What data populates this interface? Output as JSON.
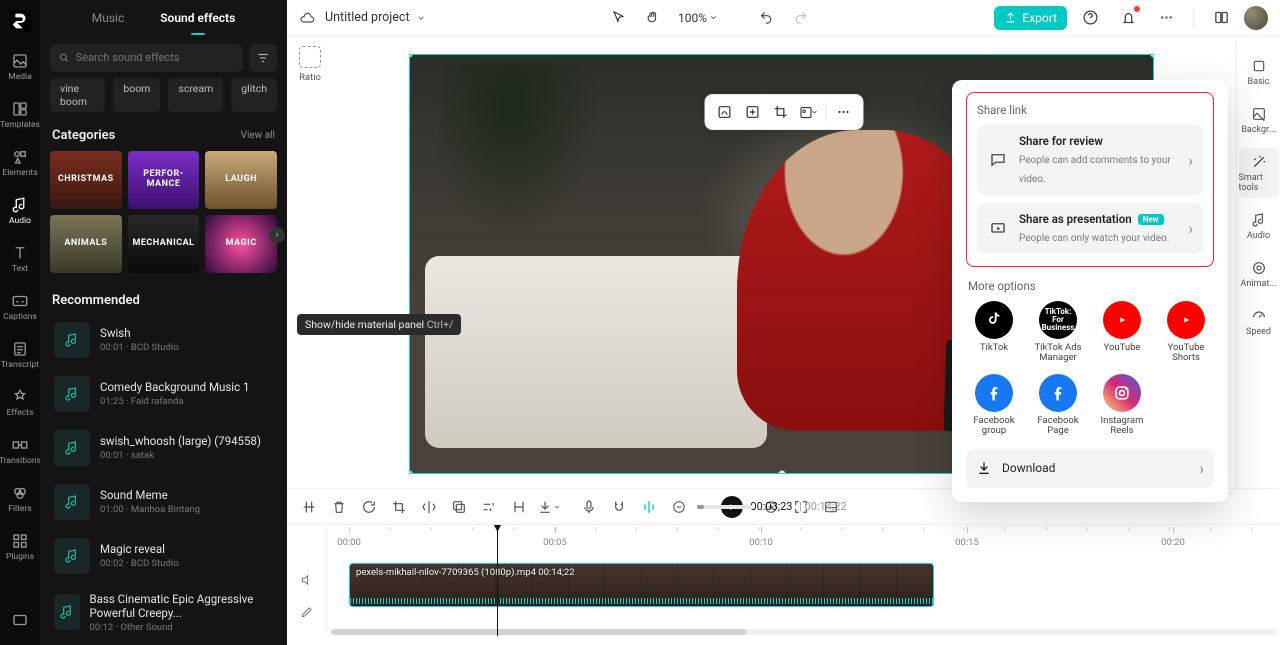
{
  "app": {
    "title": "Untitled project"
  },
  "leftSidebar": {
    "items": [
      {
        "key": "media",
        "label": "Media"
      },
      {
        "key": "templates",
        "label": "Templates"
      },
      {
        "key": "elements",
        "label": "Elements"
      },
      {
        "key": "audio",
        "label": "Audio"
      },
      {
        "key": "text",
        "label": "Text"
      },
      {
        "key": "captions",
        "label": "Captions"
      },
      {
        "key": "transcript",
        "label": "Transcript"
      },
      {
        "key": "effects",
        "label": "Effects"
      },
      {
        "key": "transitions",
        "label": "Transitions"
      },
      {
        "key": "filters",
        "label": "Filters"
      },
      {
        "key": "plugins",
        "label": "Plugins"
      }
    ]
  },
  "mediaPanel": {
    "tabs": {
      "music": "Music",
      "sfx": "Sound effects",
      "active": "sfx"
    },
    "search": {
      "placeholder": "Search sound effects"
    },
    "chips": [
      "vine boom",
      "boom",
      "scream",
      "glitch"
    ],
    "catHeader": "Categories",
    "viewAll": "View all",
    "categories": [
      [
        "CHRISTMAS",
        "PERFOR-\nMANCE",
        "LAUGH"
      ],
      [
        "ANIMALS",
        "MECHANICAL",
        "MAGIC"
      ]
    ],
    "catColors": [
      [
        "#7a2f20",
        "#7a2ec7",
        "#b38d5a"
      ],
      [
        "#6b6a55",
        "#141414",
        "#0e0e0e"
      ]
    ],
    "recHeader": "Recommended",
    "tracks": [
      {
        "title": "Swish",
        "meta": "00:01 · BCD Studio"
      },
      {
        "title": "Comedy Background Music 1",
        "meta": "01:25 · Faid rafanda"
      },
      {
        "title": "swish_whoosh (large) (794558)",
        "meta": "00:01 · satak"
      },
      {
        "title": "Sound Meme",
        "meta": "01:00 · Manhoa Bintang"
      },
      {
        "title": "Magic reveal",
        "meta": "00:02 · BCD Studio"
      },
      {
        "title": "Bass Cinematic Epic Aggressive Powerful Creepy...",
        "meta": "00:12 · Other Sound"
      }
    ]
  },
  "tooltip": {
    "text": "Show/hide material panel ",
    "kbd": "Ctrl+/"
  },
  "topbar": {
    "zoom": "100%",
    "export": "Export"
  },
  "ratioLabel": "Ratio",
  "rightTabs": [
    {
      "key": "basic",
      "label": "Basic"
    },
    {
      "key": "background",
      "label": "Backgr..."
    },
    {
      "key": "smart",
      "label": "Smart tools"
    },
    {
      "key": "audio",
      "label": "Audio"
    },
    {
      "key": "animation",
      "label": "Animat..."
    },
    {
      "key": "speed",
      "label": "Speed"
    }
  ],
  "exportPopover": {
    "shareLink": "Share link",
    "review": {
      "title": "Share for review",
      "sub": "People can add comments to your video."
    },
    "presentation": {
      "title": "Share as presentation",
      "badge": "New",
      "sub": "People can only watch your video."
    },
    "moreTitle": "More options",
    "options": [
      {
        "key": "tiktok",
        "label": "TikTok",
        "bg": "#000"
      },
      {
        "key": "ttads",
        "label": "TikTok Ads Manager",
        "bg": "#000"
      },
      {
        "key": "youtube",
        "label": "YouTube",
        "bg": "#ff0000"
      },
      {
        "key": "shorts",
        "label": "YouTube Shorts",
        "bg": "#ff0000"
      },
      {
        "key": "fbgroup",
        "label": "Facebook group",
        "bg": "#1877f2"
      },
      {
        "key": "fbpage",
        "label": "Facebook Page",
        "bg": "#1877f2"
      },
      {
        "key": "reels",
        "label": "Instagram Reels",
        "bg": "linear-gradient(45deg,#feda75,#d62976,#4f5bd5)"
      }
    ],
    "download": "Download"
  },
  "playback": {
    "current": "00:03;23",
    "total": "00:14;22"
  },
  "ruler": {
    "ticks": [
      "00:00",
      "00:05",
      "00:10",
      "00:15",
      "00:20"
    ]
  },
  "clip": {
    "label": "pexels-mikhail-nilov-7709365 (1080p).mp4    00:14;22"
  }
}
